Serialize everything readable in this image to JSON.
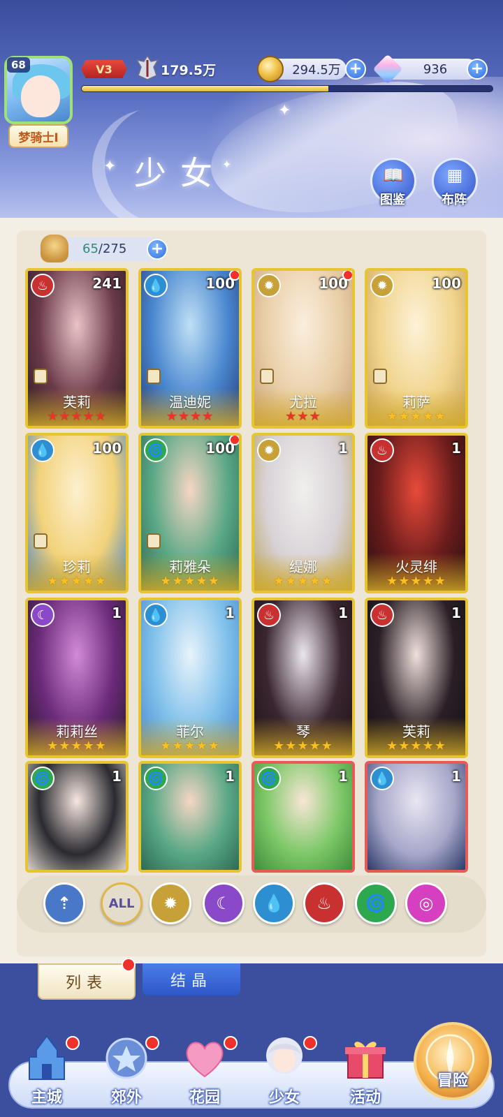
{
  "player": {
    "level": "68",
    "name": "梦骑士I",
    "vip": "V3",
    "power": "179.5万",
    "exp_progress": 0.6
  },
  "resources": {
    "gold": "294.5万",
    "gems": "936"
  },
  "header": {
    "title": "少女",
    "codex_label": "图鉴",
    "formation_label": "布阵"
  },
  "capacity": {
    "current": "65",
    "total": "/275"
  },
  "cards": [
    {
      "name": "芙莉",
      "level": "241",
      "element": "fire",
      "stars": 5,
      "red_stars": true,
      "dot": false,
      "role": true,
      "frame": "gold",
      "art": [
        "#e9c3c6",
        "#6b3a4a",
        "#2a1c24"
      ]
    },
    {
      "name": "温迪妮",
      "level": "100",
      "element": "water",
      "stars": 4,
      "red_stars": true,
      "dot": true,
      "role": true,
      "frame": "gold",
      "art": [
        "#bfe0f5",
        "#4a87cf",
        "#283f7c"
      ]
    },
    {
      "name": "尤拉",
      "level": "100",
      "element": "light",
      "stars": 3,
      "red_stars": true,
      "dot": true,
      "role": true,
      "frame": "gold",
      "art": [
        "#fbeede",
        "#e9cfa8",
        "#c9a27a"
      ]
    },
    {
      "name": "莉萨",
      "level": "100",
      "element": "light",
      "stars": 5,
      "red_stars": false,
      "dot": false,
      "role": true,
      "frame": "gold",
      "art": [
        "#fdf2d8",
        "#f1d58e",
        "#c9a35a"
      ]
    },
    {
      "name": "珍莉",
      "level": "100",
      "element": "water",
      "stars": 5,
      "red_stars": false,
      "dot": false,
      "role": true,
      "frame": "gold",
      "art": [
        "#fdf0cf",
        "#f2d27a",
        "#4a86c9"
      ]
    },
    {
      "name": "莉雅朵",
      "level": "100",
      "element": "wind",
      "stars": 5,
      "red_stars": false,
      "dot": true,
      "role": true,
      "frame": "gold",
      "art": [
        "#f6d6c4",
        "#5aa886",
        "#2d6b55"
      ]
    },
    {
      "name": "缇娜",
      "level": "1",
      "element": "light",
      "stars": 5,
      "red_stars": false,
      "dot": false,
      "role": false,
      "frame": "gold",
      "art": [
        "#f1efee",
        "#d8d2d6",
        "#b9a35a"
      ]
    },
    {
      "name": "火灵绯",
      "level": "1",
      "element": "fire",
      "stars": 5,
      "red_stars": false,
      "dot": false,
      "role": false,
      "frame": "gold",
      "art": [
        "#e84a3a",
        "#6a1c1c",
        "#2a0f10"
      ]
    },
    {
      "name": "莉莉丝",
      "level": "1",
      "element": "dark",
      "stars": 5,
      "red_stars": false,
      "dot": false,
      "role": false,
      "frame": "gold",
      "art": [
        "#d18ad6",
        "#6b2a7a",
        "#2b1b2f"
      ]
    },
    {
      "name": "菲尔",
      "level": "1",
      "element": "water",
      "stars": 5,
      "red_stars": false,
      "dot": false,
      "role": false,
      "frame": "gold",
      "art": [
        "#e8f3fb",
        "#7fc0ea",
        "#4a86cf"
      ]
    },
    {
      "name": "琴",
      "level": "1",
      "element": "fire",
      "stars": 5,
      "red_stars": false,
      "dot": false,
      "role": false,
      "frame": "gold",
      "art": [
        "#ece6f0",
        "#3a2630",
        "#1e1418"
      ]
    },
    {
      "name": "芙莉",
      "level": "1",
      "element": "fire",
      "stars": 5,
      "red_stars": false,
      "dot": false,
      "role": false,
      "frame": "gold",
      "art": [
        "#efe0dc",
        "#2a1f26",
        "#161016"
      ]
    },
    {
      "name": "",
      "level": "1",
      "element": "wind",
      "stars": 0,
      "red_stars": false,
      "dot": false,
      "role": false,
      "frame": "gold",
      "art": [
        "#f6e7e0",
        "#2a2a30",
        "#d8d0c8"
      ]
    },
    {
      "name": "",
      "level": "1",
      "element": "wind",
      "stars": 0,
      "red_stars": false,
      "dot": false,
      "role": false,
      "frame": "gold",
      "art": [
        "#f6d6c4",
        "#5aa886",
        "#2d6b55"
      ]
    },
    {
      "name": "",
      "level": "1",
      "element": "wind",
      "stars": 0,
      "red_stars": false,
      "dot": false,
      "role": false,
      "frame": "red",
      "art": [
        "#f8e6d6",
        "#7dc868",
        "#3f8e3a"
      ]
    },
    {
      "name": "",
      "level": "1",
      "element": "water",
      "stars": 0,
      "red_stars": false,
      "dot": false,
      "role": false,
      "frame": "red",
      "art": [
        "#e9e6f2",
        "#a7a7c9",
        "#2d3a6a"
      ]
    }
  ],
  "filters": [
    {
      "id": "up",
      "glyph": "⇡",
      "color": "#4a78c8"
    },
    {
      "id": "all",
      "glyph": "ALL",
      "color": "#e4ddcc"
    },
    {
      "id": "light",
      "glyph": "✹",
      "color": "#c7a137"
    },
    {
      "id": "dark",
      "glyph": "☾",
      "color": "#8a49c9"
    },
    {
      "id": "water",
      "glyph": "💧",
      "color": "#2d8fd1"
    },
    {
      "id": "fire",
      "glyph": "♨",
      "color": "#c8312f"
    },
    {
      "id": "wind",
      "glyph": "🌀",
      "color": "#2ea84f"
    },
    {
      "id": "special",
      "glyph": "◎",
      "color": "#d63fbf"
    }
  ],
  "tabs": {
    "list": "列表",
    "crystal": "结晶"
  },
  "nav": {
    "main_city": "主城",
    "outskirts": "郊外",
    "garden": "花园",
    "girls": "少女",
    "events": "活动",
    "adventure": "冒险"
  },
  "icons": {
    "water": "💧",
    "fire": "♨",
    "light": "✹",
    "wind": "🌀",
    "dark": "☾"
  }
}
